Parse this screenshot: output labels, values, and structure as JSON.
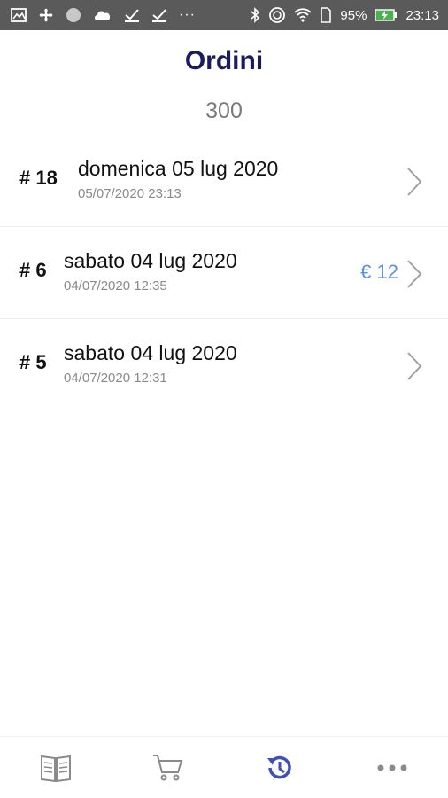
{
  "status_bar": {
    "battery_percent": "95%",
    "time": "23:13",
    "overflow": "···"
  },
  "header": {
    "title": "Ordini",
    "subtitle": "300"
  },
  "orders": [
    {
      "number": "# 18",
      "date": "domenica 05 lug 2020",
      "timestamp": "05/07/2020 23:13",
      "amount": ""
    },
    {
      "number": "# 6",
      "date": "sabato 04 lug 2020",
      "timestamp": "04/07/2020 12:35",
      "amount": "€ 12"
    },
    {
      "number": "# 5",
      "date": "sabato 04 lug 2020",
      "timestamp": "04/07/2020 12:31",
      "amount": ""
    }
  ],
  "bottom_nav": [
    {
      "icon": "book-icon",
      "active": false
    },
    {
      "icon": "cart-icon",
      "active": false
    },
    {
      "icon": "history-icon",
      "active": true
    },
    {
      "icon": "more-icon",
      "active": false
    }
  ],
  "colors": {
    "title": "#1a1a5e",
    "accent": "#3f51b5",
    "amount": "#5b8fe0",
    "status_bar": "#5a5a5a",
    "battery": "#4caf50"
  }
}
